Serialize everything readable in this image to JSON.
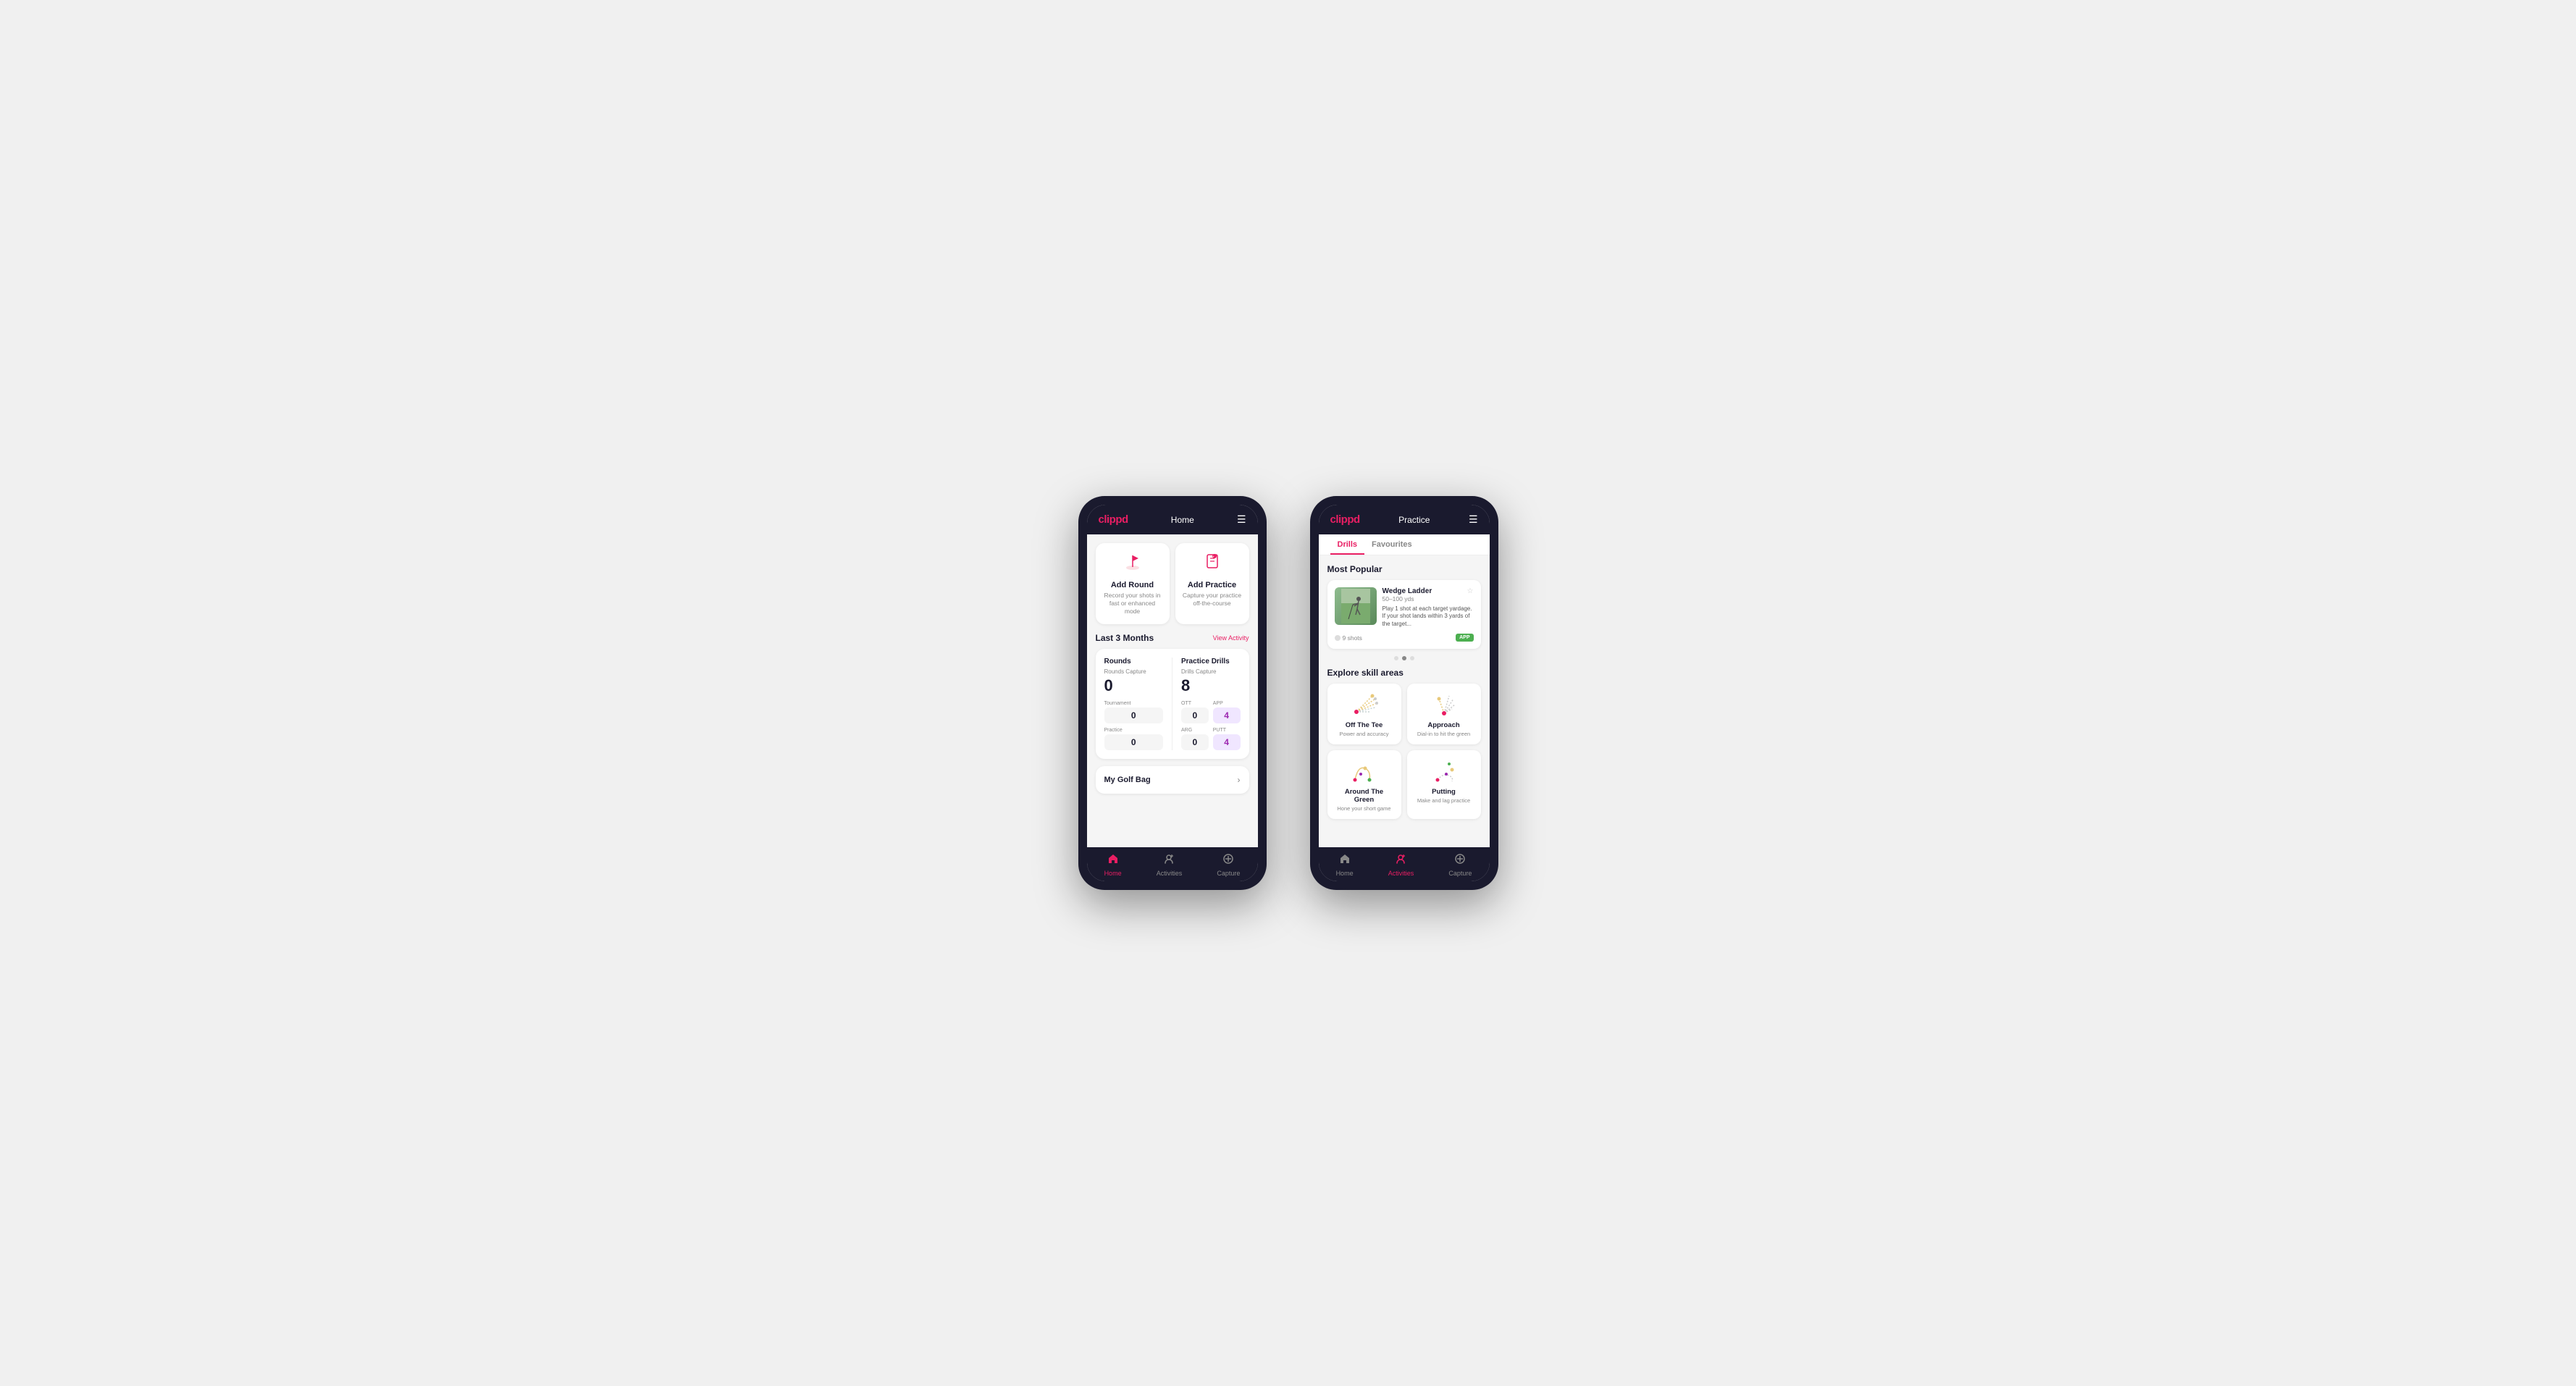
{
  "phone1": {
    "header": {
      "logo": "clippd",
      "title": "Home",
      "menu_icon": "☰"
    },
    "cards": [
      {
        "id": "add-round",
        "title": "Add Round",
        "subtitle": "Record your shots in fast or enhanced mode",
        "icon": "⛳"
      },
      {
        "id": "add-practice",
        "title": "Add Practice",
        "subtitle": "Capture your practice off-the-course",
        "icon": "📋"
      }
    ],
    "activity": {
      "section_title": "Last 3 Months",
      "view_link": "View Activity"
    },
    "stats": {
      "rounds_title": "Rounds",
      "rounds_capture": "Rounds Capture",
      "rounds_value": "0",
      "tournament_label": "Tournament",
      "tournament_value": "0",
      "practice_label": "Practice",
      "practice_value": "0",
      "drills_title": "Practice Drills",
      "drills_capture": "Drills Capture",
      "drills_value": "8",
      "ott_label": "OTT",
      "ott_value": "0",
      "app_label": "APP",
      "app_value": "4",
      "arg_label": "ARG",
      "arg_value": "0",
      "putt_label": "PUTT",
      "putt_value": "4"
    },
    "golf_bag": {
      "label": "My Golf Bag"
    },
    "nav": [
      {
        "icon": "🏠",
        "label": "Home",
        "active": true
      },
      {
        "icon": "🏌",
        "label": "Activities",
        "active": false
      },
      {
        "icon": "⊕",
        "label": "Capture",
        "active": false
      }
    ]
  },
  "phone2": {
    "header": {
      "logo": "clippd",
      "title": "Practice",
      "menu_icon": "☰"
    },
    "tabs": [
      {
        "label": "Drills",
        "active": true
      },
      {
        "label": "Favourites",
        "active": false
      }
    ],
    "most_popular": {
      "section_title": "Most Popular",
      "card": {
        "title": "Wedge Ladder",
        "range": "50–100 yds",
        "description": "Play 1 shot at each target yardage. If your shot lands within 3 yards of the target...",
        "shots": "9 shots",
        "badge": "APP"
      }
    },
    "dots": [
      false,
      true,
      false
    ],
    "skill_areas": {
      "section_title": "Explore skill areas",
      "items": [
        {
          "id": "off-the-tee",
          "title": "Off The Tee",
          "subtitle": "Power and accuracy"
        },
        {
          "id": "approach",
          "title": "Approach",
          "subtitle": "Dial-in to hit the green"
        },
        {
          "id": "around-the-green",
          "title": "Around The Green",
          "subtitle": "Hone your short game"
        },
        {
          "id": "putting",
          "title": "Putting",
          "subtitle": "Make and lag practice"
        }
      ]
    },
    "nav": [
      {
        "icon": "🏠",
        "label": "Home",
        "active": false
      },
      {
        "icon": "🏌",
        "label": "Activities",
        "active": true
      },
      {
        "icon": "⊕",
        "label": "Capture",
        "active": false
      }
    ]
  }
}
